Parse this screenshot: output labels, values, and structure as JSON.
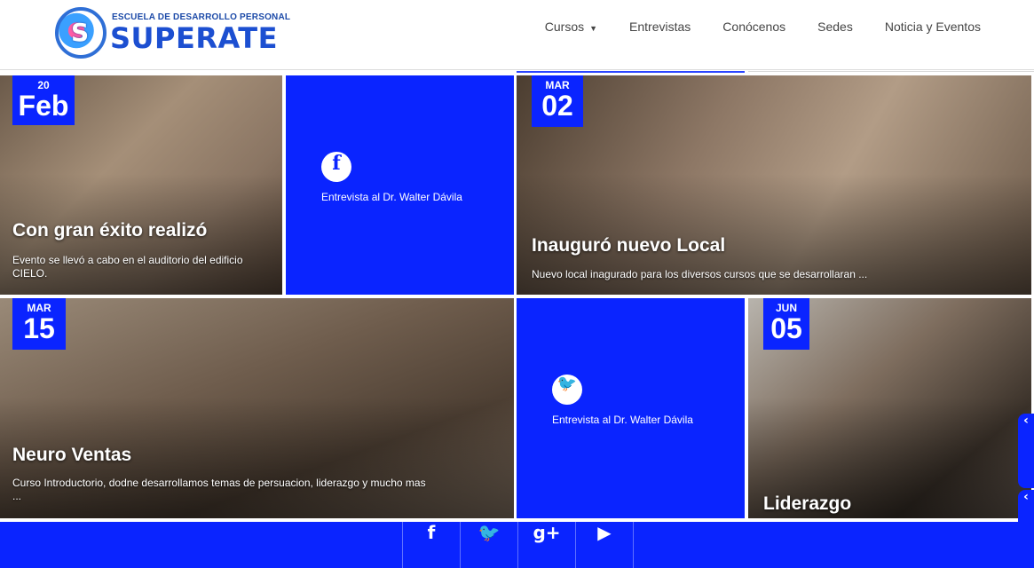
{
  "header": {
    "logo_tagline": "ESCUELA DE DESARROLLO PERSONAL",
    "logo_brand": "SUPERATE",
    "nav": [
      {
        "label": "Cursos",
        "has_dropdown": true
      },
      {
        "label": "Entrevistas"
      },
      {
        "label": "Conócenos"
      },
      {
        "label": "Sedes"
      },
      {
        "label": "Noticia y Eventos"
      }
    ]
  },
  "tiles": {
    "event1": {
      "month": "20",
      "day": "Feb",
      "title": "Con gran éxito realizó",
      "description": "Evento se llevó a cabo en el auditorio del edificio CIELO."
    },
    "social1": {
      "icon": "facebook-icon",
      "glyph": "f",
      "text": "Entrevista al Dr. Walter Dávila"
    },
    "event2": {
      "month": "MAR",
      "day": "02",
      "title": "Inauguró nuevo Local",
      "description": "Nuevo local inagurado para los diversos cursos que se desarrollaran ..."
    },
    "event3": {
      "month": "MAR",
      "day": "15",
      "title": "Neuro Ventas",
      "description": "Curso Introductorio, dodne desarrollamos temas de persuacion, liderazgo y mucho mas ..."
    },
    "social2": {
      "icon": "twitter-icon",
      "glyph": "🐦",
      "text": "Entrevista al Dr. Walter Dávila"
    },
    "event4": {
      "month": "JUN",
      "day": "05",
      "title": "Liderazgo"
    }
  },
  "footer": {
    "icons": [
      {
        "name": "facebook-icon",
        "glyph": "f"
      },
      {
        "name": "twitter-icon",
        "glyph": "🐦"
      },
      {
        "name": "google-plus-icon",
        "glyph": "g+"
      },
      {
        "name": "youtube-icon",
        "glyph": "▶"
      }
    ]
  },
  "side_buttons": [
    {
      "glyph": "‹"
    },
    {
      "glyph": "‹"
    }
  ],
  "colors": {
    "accent": "#0a24ff",
    "brand": "#1c4fd1"
  }
}
